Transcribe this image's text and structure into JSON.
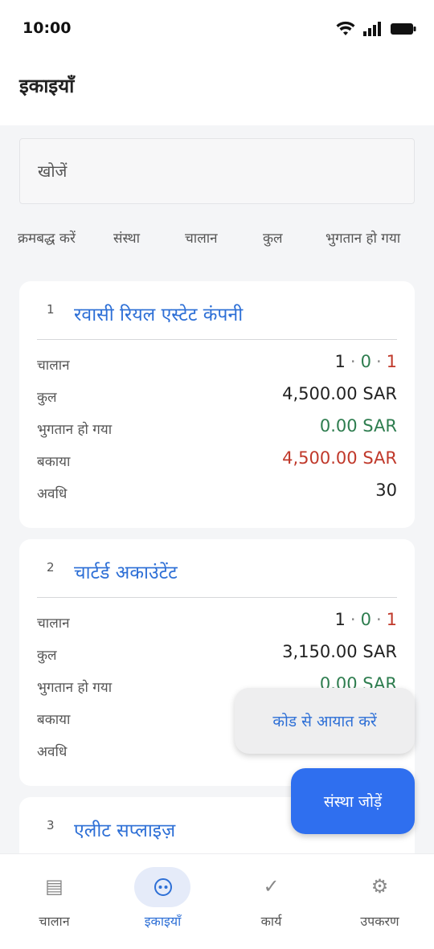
{
  "status_bar": {
    "time": "10:00"
  },
  "app_bar": {
    "title": "इकाइयाँ"
  },
  "search": {
    "placeholder": "खोजें"
  },
  "sort_bar": {
    "label": "क्रमबद्ध करें",
    "options": [
      "संस्था",
      "चालान",
      "कुल",
      "भुगतान हो गया"
    ]
  },
  "entities": [
    {
      "index": "1",
      "name": "रवासी रियल एस्टेट कंपनी",
      "invoices_label": "चालान",
      "invoices": {
        "total": "1",
        "paid": "0",
        "unpaid": "1",
        "sep": "·"
      },
      "total_label": "कुल",
      "total": "4,500.00 SAR",
      "paid_label": "भुगतान हो गया",
      "paid": "0.00 SAR",
      "due_label": "बकाया",
      "due": "4,500.00 SAR",
      "term_label": "अवधि",
      "term": "30"
    },
    {
      "index": "2",
      "name": "चार्टर्ड अकाउंटेंट",
      "invoices_label": "चालान",
      "invoices": {
        "total": "1",
        "paid": "0",
        "unpaid": "1",
        "sep": "·"
      },
      "total_label": "कुल",
      "total": "3,150.00 SAR",
      "paid_label": "भुगतान हो गया",
      "paid": "0.00 SAR",
      "due_label": "बकाया",
      "due": "",
      "term_label": "अवधि",
      "term": ""
    },
    {
      "index": "3",
      "name": "एलीट सप्लाइज़"
    }
  ],
  "actions": {
    "import_by_code": "कोड से आयात करें",
    "add_entity": "संस्था जोड़ें"
  },
  "bottom_nav": {
    "items": [
      {
        "label": "चालान",
        "icon": "list-icon"
      },
      {
        "label": "इकाइयाँ",
        "icon": "entities-icon",
        "active": true
      },
      {
        "label": "कार्य",
        "icon": "check-icon"
      },
      {
        "label": "उपकरण",
        "icon": "gear-icon"
      }
    ]
  },
  "colors": {
    "accent": "#2f6fef",
    "link": "#2d6fd6",
    "positive": "#2e7d4f",
    "negative": "#c0392b"
  }
}
